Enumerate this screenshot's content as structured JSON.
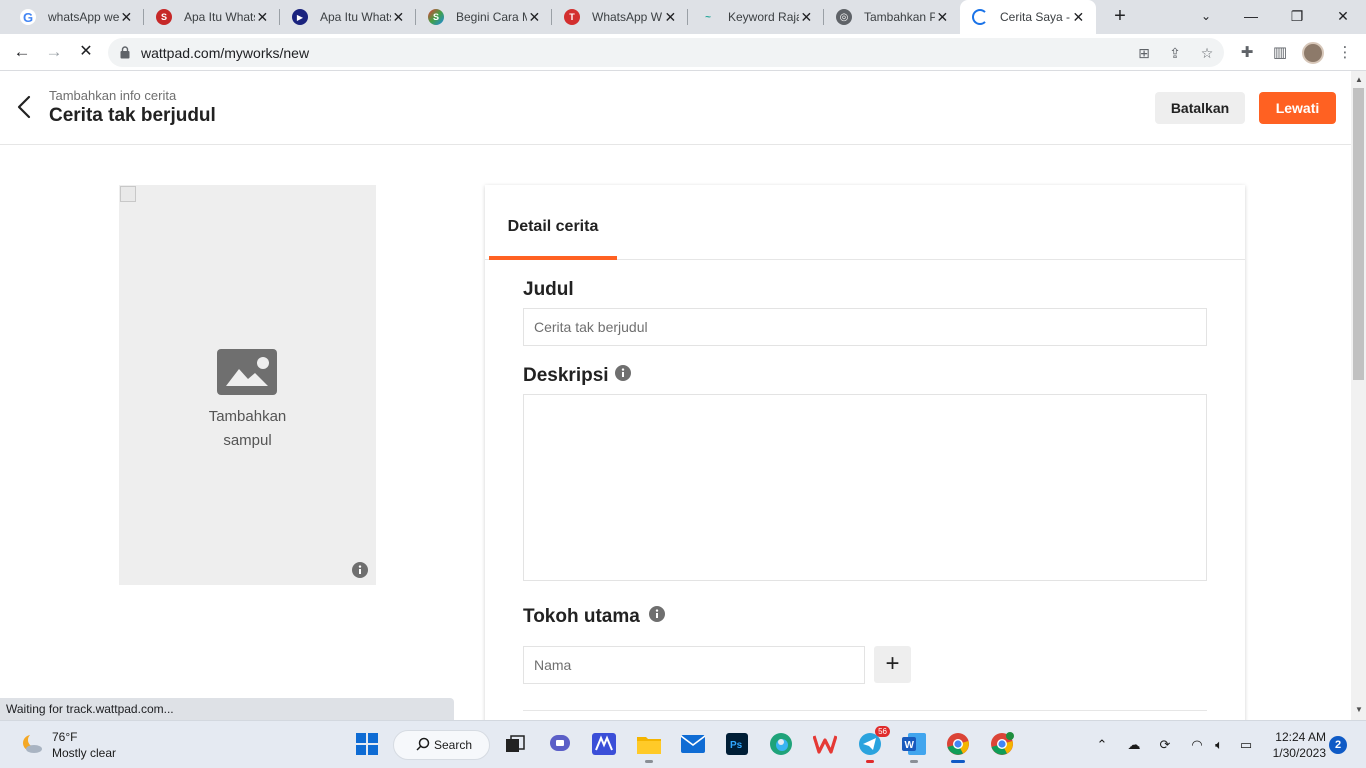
{
  "browser": {
    "tabs": [
      {
        "title": "whatsApp we",
        "favicon": "google-icon",
        "color": "#4285f4",
        "letter": "G"
      },
      {
        "title": "Apa Itu Whats",
        "favicon": "s-logo-icon",
        "color": "#c62828",
        "letter": "S"
      },
      {
        "title": "Apa Itu Whats",
        "favicon": "play-logo-icon",
        "color": "#1a237e",
        "letter": "▶"
      },
      {
        "title": "Begini Cara M",
        "favicon": "s-swirl-icon",
        "color": "#2e7d32",
        "letter": "S"
      },
      {
        "title": "WhatsApp W",
        "favicon": "t-logo-icon",
        "color": "#d32f2f",
        "letter": "T"
      },
      {
        "title": "Keyword Raja",
        "favicon": "keyword-icon",
        "color": "#26a69a",
        "letter": "~"
      },
      {
        "title": "Tambahkan Pi",
        "favicon": "globe-icon",
        "color": "#5f6368",
        "letter": "◎"
      },
      {
        "title": "Cerita Saya -",
        "favicon": "loading-icon",
        "color": "#1a73e8",
        "letter": ""
      }
    ],
    "url": "wattpad.com/myworks/new",
    "status_text": "Waiting for track.wattpad.com..."
  },
  "page": {
    "breadcrumb": "Tambahkan info cerita",
    "story_title": "Cerita tak berjudul",
    "cancel_label": "Batalkan",
    "skip_label": "Lewati",
    "accent_color": "#ff6122",
    "cover": {
      "add_label_line1": "Tambahkan",
      "add_label_line2": "sampul"
    },
    "details": {
      "tab_label": "Detail cerita",
      "title_label": "Judul",
      "title_placeholder": "Cerita tak berjudul",
      "description_label": "Deskripsi",
      "description_value": "",
      "main_character_label": "Tokoh utama",
      "name_placeholder": "Nama",
      "add_button_label": "+"
    }
  },
  "taskbar": {
    "weather_temp": "76°F",
    "weather_condition": "Mostly clear",
    "search_label": "Search",
    "telegram_badge": "56",
    "time": "12:24 AM",
    "date": "1/30/2023",
    "notification_count": "2"
  }
}
